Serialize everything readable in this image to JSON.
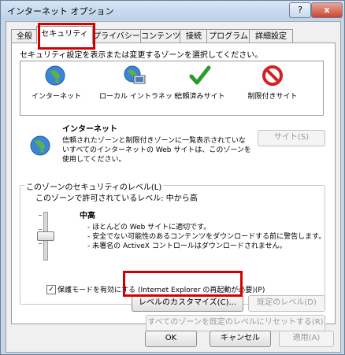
{
  "window": {
    "title": "インターネット オプション",
    "help": "?",
    "close": "x"
  },
  "tabs": [
    "全般",
    "セキュリティ",
    "プライバシー",
    "コンテンツ",
    "接続",
    "プログラム",
    "詳細設定"
  ],
  "zone_prompt": "セキュリティ設定を表示または変更するゾーンを選択してください。",
  "zones": [
    {
      "label": "インターネット",
      "icon": "globe-icon"
    },
    {
      "label": "ローカル イントラネット",
      "icon": "intranet-icon"
    },
    {
      "label": "信頼済みサイト",
      "icon": "checkmark-icon"
    },
    {
      "label": "制限付きサイト",
      "icon": "restricted-icon"
    }
  ],
  "selected_zone": {
    "title": "インターネット",
    "desc": [
      "信頼されたゾーンと制限付きゾーンに一覧表示されていな",
      "いすべてのインターネットの Web サイトは、このゾーンを",
      "使用してください。"
    ],
    "sites_button": "サイト(S)"
  },
  "security_level": {
    "group_title": "このゾーンのセキュリティのレベル(L)",
    "allowed": "このゾーンで許可されているレベル: 中から高",
    "level_name": "中高",
    "bullets": [
      "- ほとんどの Web サイトに適切です。",
      "- 安全でない可能性のあるコンテンツをダウンロードする前に警告します。",
      "- 未署名の ActiveX コントロールはダウンロードされません。"
    ],
    "level_fraction": 0.5
  },
  "protected_mode": {
    "label": "保護モードを有効にする (Internet Explorer の再起動が必要)(P)",
    "checked": true,
    "mark": "✓"
  },
  "buttons": {
    "custom_level": "レベルのカスタマイズ(C)...",
    "default_level": "既定のレベル(D)",
    "reset_all": "すべてのゾーンを既定のレベルにリセットする(R)",
    "ok": "OK",
    "cancel": "キャンセル",
    "apply": "適用(A)"
  },
  "colors": {
    "highlight": "#d40000"
  }
}
